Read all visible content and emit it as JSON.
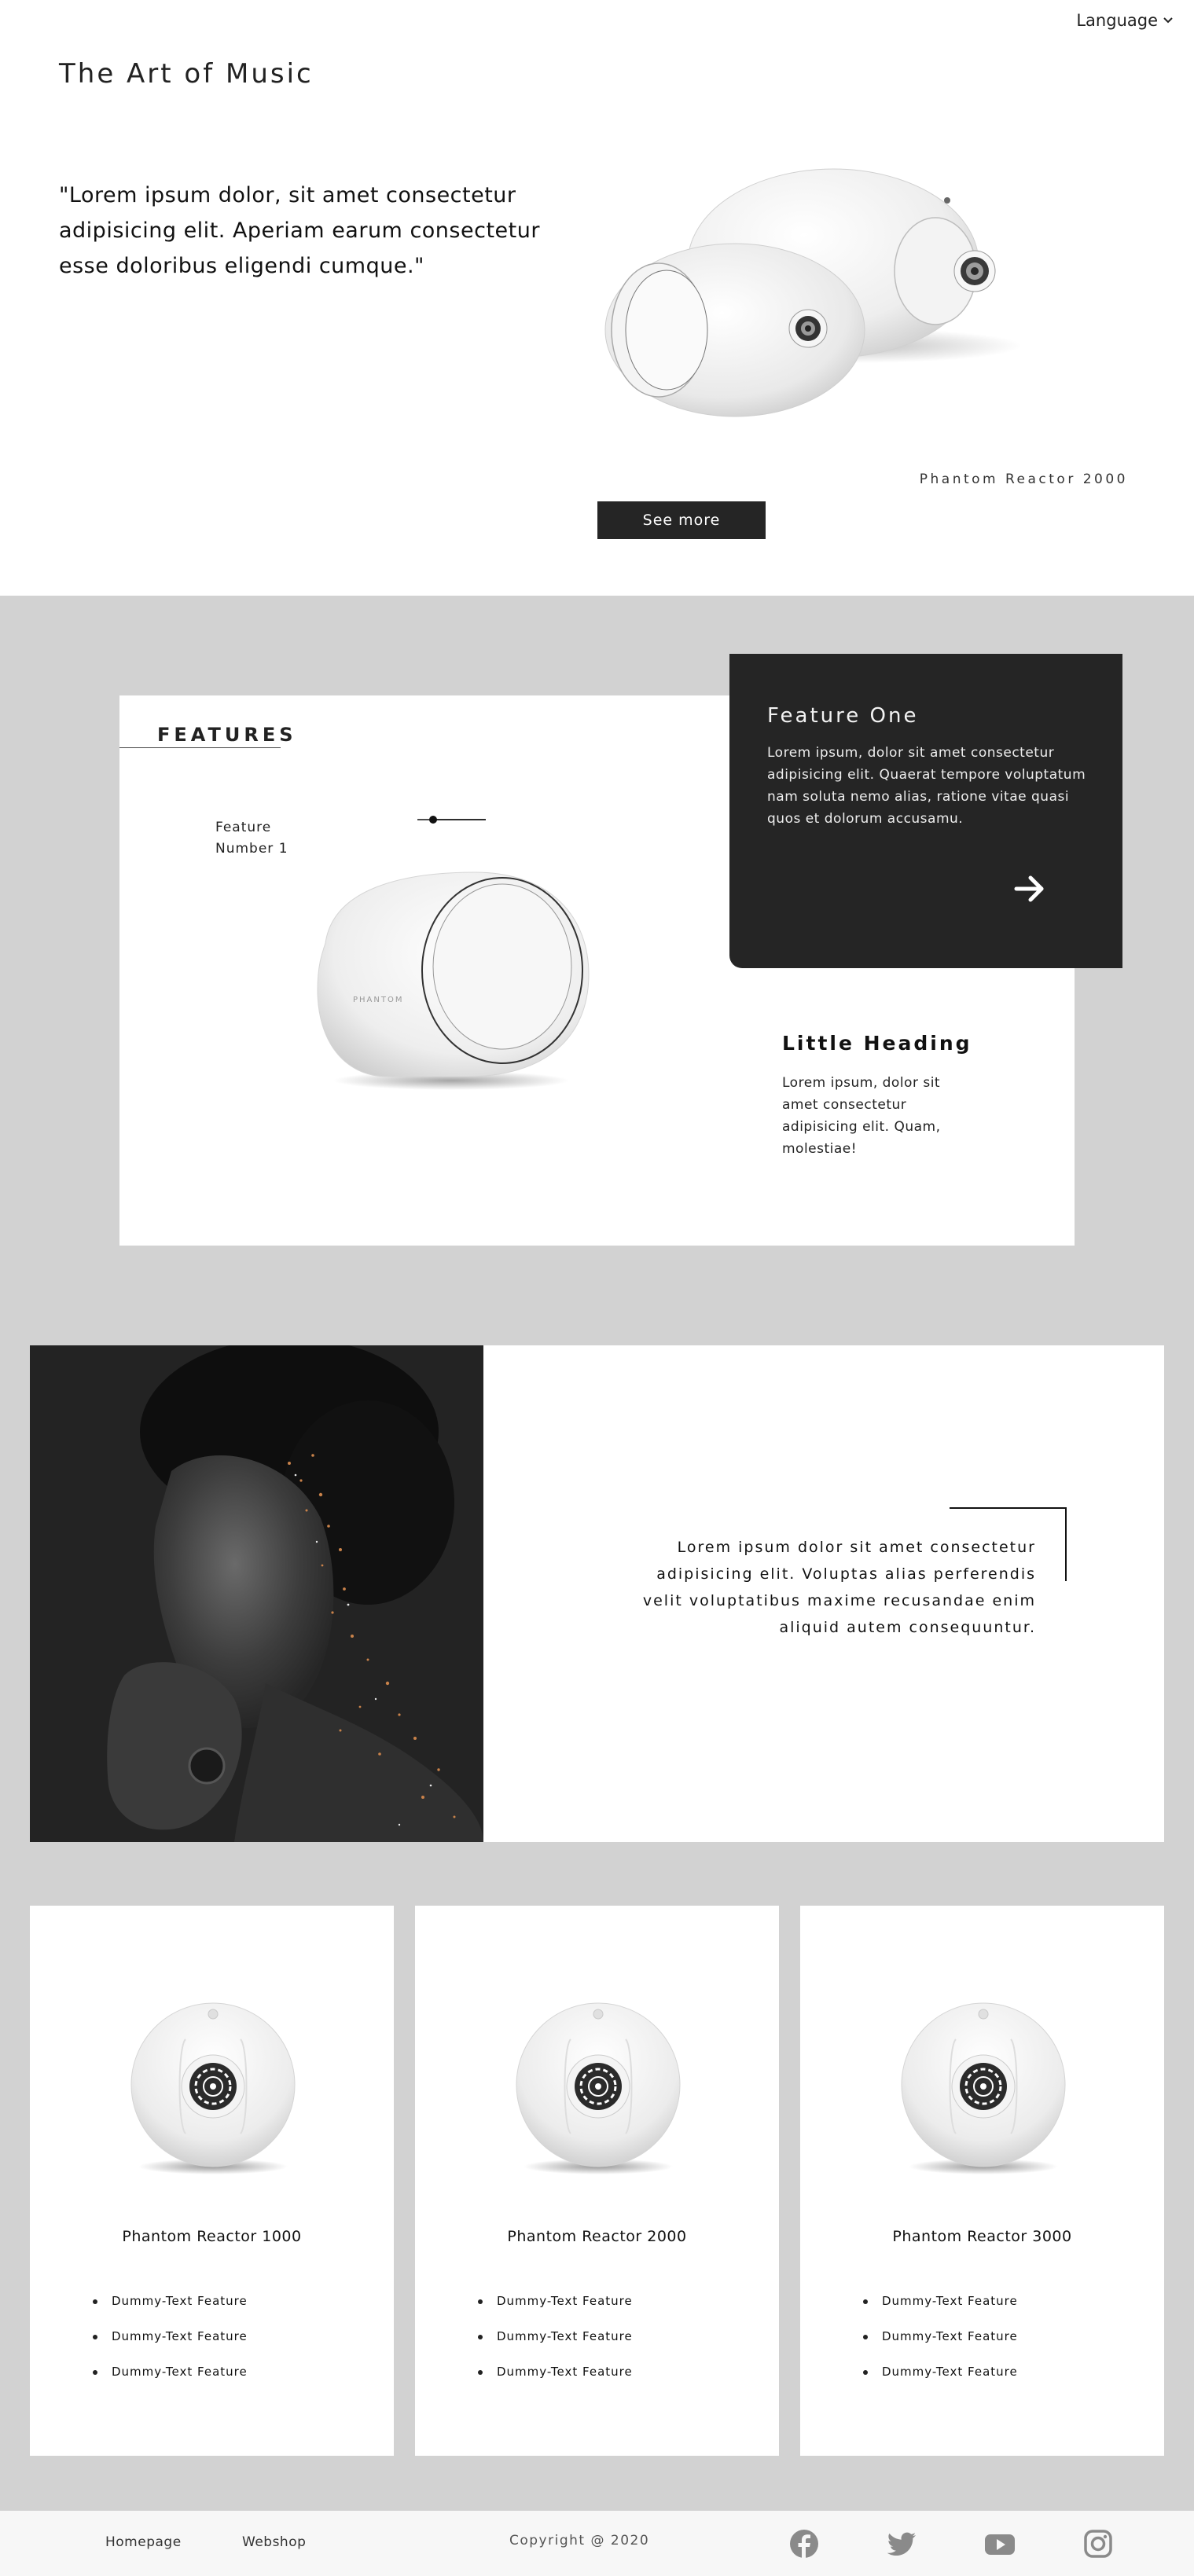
{
  "header": {
    "language_label": "Language",
    "site_title": "The Art of Music"
  },
  "hero": {
    "quote": "\"Lorem ipsum dolor, sit amet consectetur adipisicing elit. Aperiam earum consectetur esse doloribus eligendi cumque.\"",
    "product_caption": "Phantom Reactor 2000",
    "button_label": "See more"
  },
  "features": {
    "title": "FEATURES",
    "feature_label_line1": "Feature",
    "feature_label_line2": "Number 1",
    "feature_one": {
      "heading": "Feature One",
      "text": "Lorem ipsum, dolor sit amet consectetur adipisicing elit. Quaerat tempore voluptatum nam soluta nemo alias, ratione vitae quasi quos et dolorum accusamu."
    },
    "little_heading": "Little Heading",
    "little_text": "Lorem ipsum, dolor sit amet consectetur adipisicing elit. Quam, molestiae!"
  },
  "portrait_section": {
    "text": "Lorem ipsum dolor sit amet consectetur adipisicing elit. Voluptas alias perferendis velit voluptatibus maxime recusandae enim aliquid autem consequuntur."
  },
  "products": [
    {
      "name": "Phantom Reactor 1000",
      "features": [
        "Dummy-Text Feature",
        "Dummy-Text Feature",
        "Dummy-Text Feature"
      ]
    },
    {
      "name": "Phantom Reactor 2000",
      "features": [
        "Dummy-Text Feature",
        "Dummy-Text Feature",
        "Dummy-Text Feature"
      ]
    },
    {
      "name": "Phantom Reactor 3000",
      "features": [
        "Dummy-Text Feature",
        "Dummy-Text Feature",
        "Dummy-Text Feature"
      ]
    }
  ],
  "footer": {
    "links": [
      "Homepage",
      "Webshop"
    ],
    "copyright": "Copyright @ 2020",
    "social_icons": [
      "facebook-icon",
      "twitter-icon",
      "youtube-icon",
      "instagram-icon"
    ]
  },
  "colors": {
    "page_bg": "#ffffff",
    "section_grey": "#d2d2d2",
    "dark_panel": "#252525",
    "footer_bg": "#f7f7f7",
    "icon_grey": "#8a8a8a"
  }
}
